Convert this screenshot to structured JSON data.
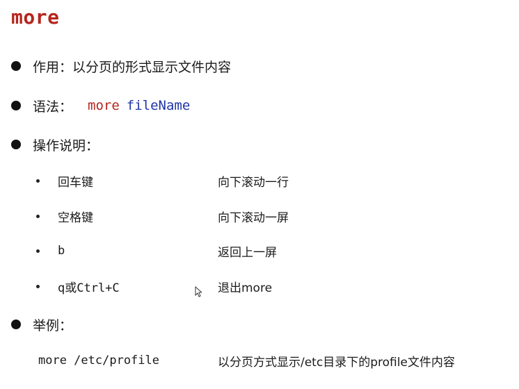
{
  "title": "more",
  "items": {
    "purpose": {
      "label": "作用：以分页的形式显示文件内容"
    },
    "syntax": {
      "label": "语法：",
      "command": "more",
      "argument": "fileName"
    },
    "operations": {
      "label": "操作说明："
    },
    "example": {
      "label": "举例："
    }
  },
  "operations": [
    {
      "key": "回车键",
      "description": "向下滚动一行"
    },
    {
      "key": "空格键",
      "description": "向下滚动一屏"
    },
    {
      "key": "b",
      "description": "返回上一屏"
    },
    {
      "key": "q或Ctrl+C",
      "description": "退出more"
    }
  ],
  "example": {
    "command": "more /etc/profile",
    "description": "以分页方式显示/etc目录下的profile文件内容"
  },
  "colors": {
    "title": "#b5261e",
    "command": "#b5261e",
    "argument": "#1f35a6",
    "text": "#1a1a1a"
  },
  "icons": {
    "bullet": "filled-circle",
    "sub_bullet": "small-dot",
    "cursor": "mouse-pointer-icon"
  }
}
